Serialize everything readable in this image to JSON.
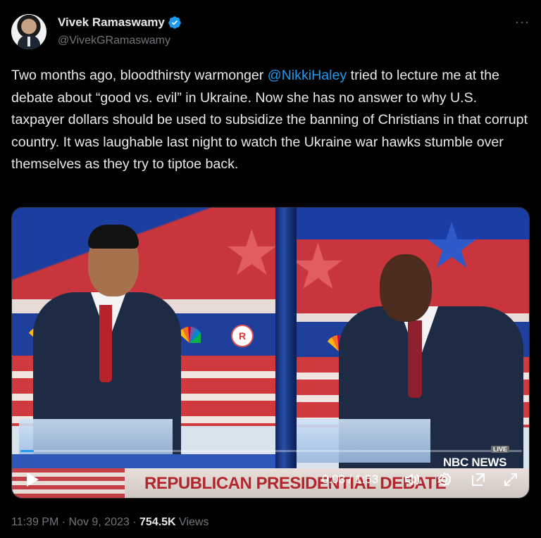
{
  "author": {
    "name": "Vivek Ramaswamy",
    "handle": "@VivekGRamaswamy",
    "verified": true,
    "icons": {
      "verified": "verified-badge-icon",
      "more": "more-options-icon",
      "avatar": "avatar"
    }
  },
  "tweet": {
    "text_before": "Two months ago, bloodthirsty warmonger ",
    "mention": "@NikkiHaley",
    "text_after": " tried to lecture me at the debate about “good vs. evil” in Ukraine. Now she has no answer to why U.S. taxpayer dollars should be used to subsidize the banning of Christians in that corrupt country. It was laughable last night to watch the Ukraine war hawks stumble over themselves as they try to tiptoe back."
  },
  "video": {
    "banner_text": "REPUBLICAN PRESIDENTIAL DEBATE",
    "network": "NBC NEWS",
    "live_label": "LIVE",
    "time_display": "0:03 / 1:53",
    "progress_fraction": 0.027,
    "controls": [
      "play-icon",
      "volume-icon",
      "settings-icon",
      "picture-in-picture-icon",
      "fullscreen-icon"
    ]
  },
  "footer": {
    "time": "11:39 PM",
    "separator": " · ",
    "date": "Nov 9, 2023",
    "views_count": "754.5K",
    "views_label": " Views"
  },
  "colors": {
    "accent": "#1d9bf0",
    "text": "#e7e9ea",
    "muted": "#71767b",
    "background": "#000000"
  }
}
